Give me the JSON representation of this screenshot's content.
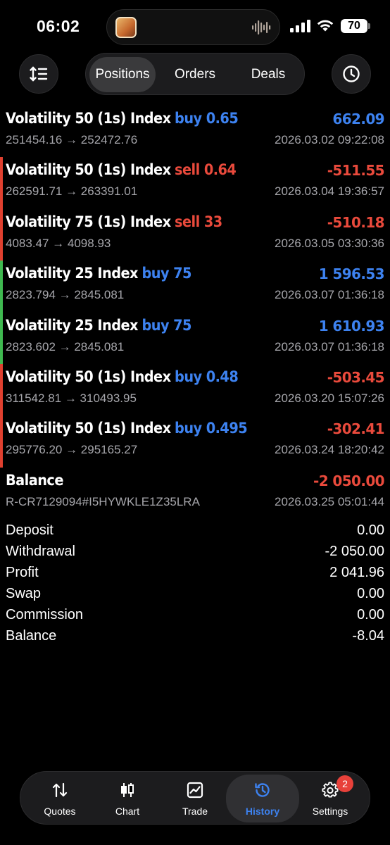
{
  "status": {
    "time": "06:02",
    "battery": "70"
  },
  "header": {
    "tabs": [
      "Positions",
      "Orders",
      "Deals"
    ]
  },
  "deals": [
    {
      "symbol": "Volatility 50 (1s) Index",
      "direction": "buy 0.65",
      "dir_type": "buy",
      "prices": "251454.16 → 252472.76",
      "profit": "662.09",
      "profit_sign": "positive",
      "time": "2026.03.02 09:22:08",
      "bar": "none"
    },
    {
      "symbol": "Volatility 50 (1s) Index",
      "direction": "sell 0.64",
      "dir_type": "sell",
      "prices": "262591.71 → 263391.01",
      "profit": "-511.55",
      "profit_sign": "negative",
      "time": "2026.03.04 19:36:57",
      "bar": "red"
    },
    {
      "symbol": "Volatility 75 (1s) Index",
      "direction": "sell 33",
      "dir_type": "sell",
      "prices": "4083.47 → 4098.93",
      "profit": "-510.18",
      "profit_sign": "negative",
      "time": "2026.03.05 03:30:36",
      "bar": "red"
    },
    {
      "symbol": "Volatility 25 Index",
      "direction": "buy 75",
      "dir_type": "buy",
      "prices": "2823.794 → 2845.081",
      "profit": "1 596.53",
      "profit_sign": "positive",
      "time": "2026.03.07 01:36:18",
      "bar": "green"
    },
    {
      "symbol": "Volatility 25 Index",
      "direction": "buy 75",
      "dir_type": "buy",
      "prices": "2823.602 → 2845.081",
      "profit": "1 610.93",
      "profit_sign": "positive",
      "time": "2026.03.07 01:36:18",
      "bar": "green"
    },
    {
      "symbol": "Volatility 50 (1s) Index",
      "direction": "buy 0.48",
      "dir_type": "buy",
      "prices": "311542.81 → 310493.95",
      "profit": "-503.45",
      "profit_sign": "negative",
      "time": "2026.03.20 15:07:26",
      "bar": "red"
    },
    {
      "symbol": "Volatility 50 (1s) Index",
      "direction": "buy 0.495",
      "dir_type": "buy",
      "prices": "295776.20 → 295165.27",
      "profit": "-302.41",
      "profit_sign": "negative",
      "time": "2026.03.24 18:20:42",
      "bar": "red"
    },
    {
      "symbol": "Balance",
      "direction": "",
      "dir_type": "",
      "prices": "R-CR7129094#I5HYWKLE1Z35LRA",
      "profit": "-2 050.00",
      "profit_sign": "negative",
      "time": "2026.03.25 05:01:44",
      "bar": "none"
    }
  ],
  "summary": [
    {
      "label": "Deposit",
      "value": "0.00"
    },
    {
      "label": "Withdrawal",
      "value": "-2 050.00"
    },
    {
      "label": "Profit",
      "value": "2 041.96"
    },
    {
      "label": "Swap",
      "value": "0.00"
    },
    {
      "label": "Commission",
      "value": "0.00"
    },
    {
      "label": "Balance",
      "value": "-8.04"
    }
  ],
  "tabbar": {
    "items": [
      {
        "label": "Quotes",
        "icon": "quotes-icon"
      },
      {
        "label": "Chart",
        "icon": "chart-icon"
      },
      {
        "label": "Trade",
        "icon": "trade-icon"
      },
      {
        "label": "History",
        "icon": "history-icon"
      },
      {
        "label": "Settings",
        "icon": "gear-icon"
      }
    ],
    "active": "History",
    "settings_badge": "2"
  },
  "colors": {
    "buy": "#3d82f0",
    "sell": "#ea4a3c",
    "positive": "#3d82f0",
    "negative": "#ea4a3c",
    "accent": "#3d82f0"
  }
}
